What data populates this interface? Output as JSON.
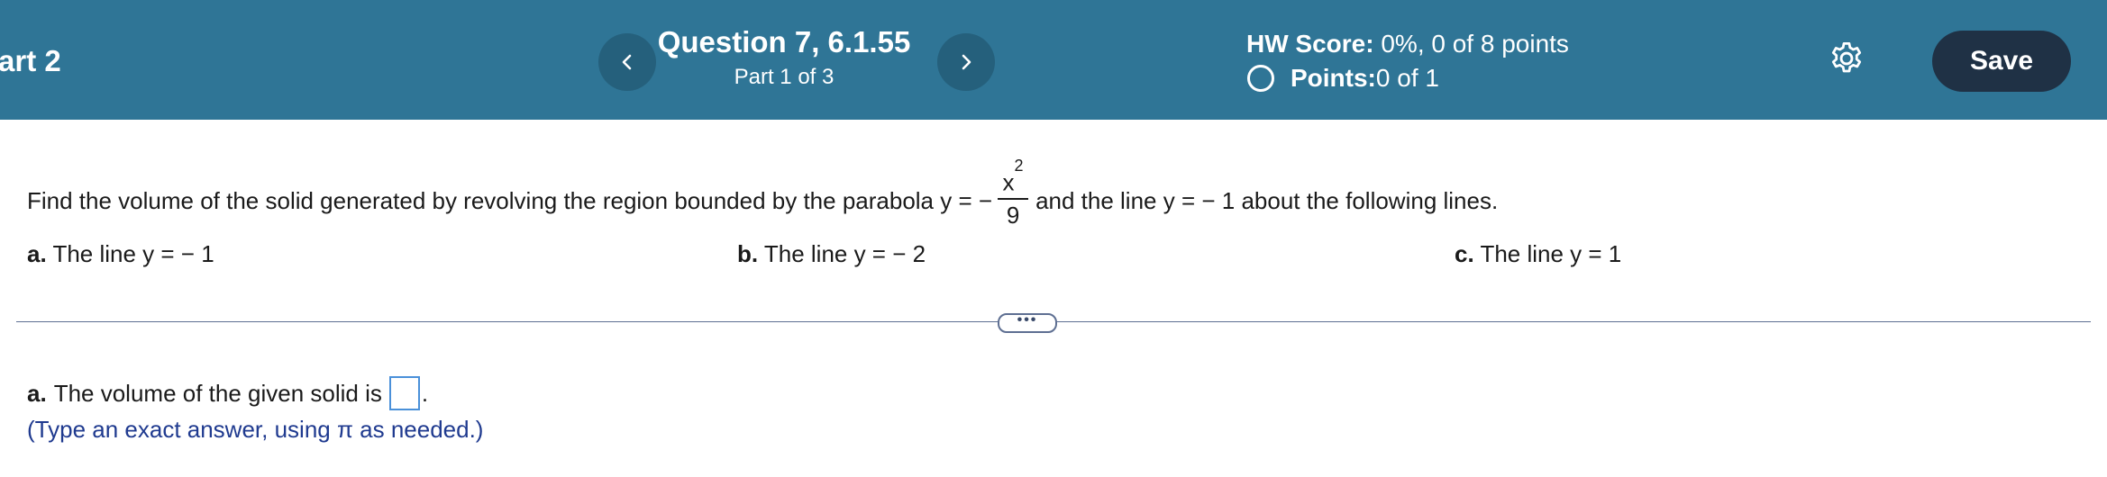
{
  "header": {
    "left_title": "art 2",
    "question_title": "Question 7, 6.1.55",
    "question_part": "Part 1 of 3",
    "hw_score_label": "HW Score:",
    "hw_score_value": " 0%, 0 of 8 points",
    "points_label": "Points:",
    "points_value": " 0 of 1",
    "save_label": "Save",
    "prev_icon": "chevron-left-icon",
    "next_icon": "chevron-right-icon",
    "settings_icon": "gear-icon"
  },
  "problem": {
    "text_before": "Find the volume of the solid generated by revolving the region bounded by the parabola y = −",
    "frac_num": "x",
    "frac_exp": "2",
    "frac_den": "9",
    "text_after": "and the line y = − 1 about the following lines."
  },
  "parts": [
    {
      "letter": "a.",
      "text": " The line y = − 1"
    },
    {
      "letter": "b.",
      "text": " The line y = − 2"
    },
    {
      "letter": "c.",
      "text": " The line y = 1"
    }
  ],
  "expand_label": "•••",
  "answer": {
    "letter": "a.",
    "text": "The volume of the given solid is",
    "end": ".",
    "value": "",
    "hint": "(Type an exact answer, using π as needed.)"
  },
  "colors": {
    "header_bg": "#2f7596",
    "nav_btn_bg": "#25607c",
    "save_bg": "#1f3145",
    "hint_text": "#1f3a8f",
    "answer_box_border": "#4a90d9"
  }
}
